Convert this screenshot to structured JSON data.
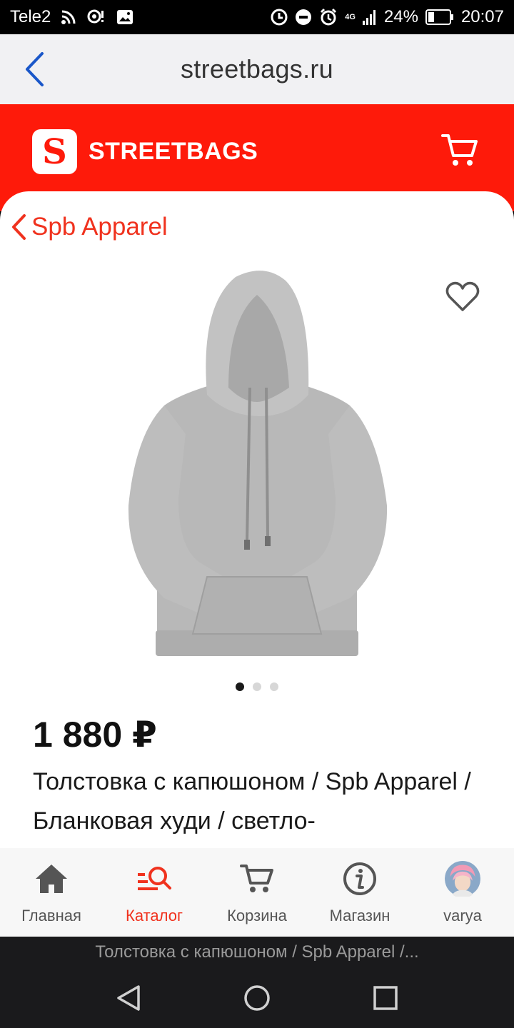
{
  "status_bar": {
    "carrier": "Tele2",
    "network": "4G",
    "battery": "24%",
    "time": "20:07"
  },
  "browser": {
    "url": "streetbags.ru"
  },
  "header": {
    "logo_letter": "S",
    "brand": "STREETBAGS",
    "accent_color": "#fe1a0a"
  },
  "product": {
    "breadcrumb": "Spb Apparel",
    "price": "1 880 ₽",
    "title": "Толстовка с капюшоном / Spb Apparel / Бланковая худи / светло-",
    "image_count": 3,
    "active_image": 1,
    "image_icon": "grey-hoodie"
  },
  "bottom_nav": {
    "items": [
      {
        "label": "Главная",
        "icon": "home-icon"
      },
      {
        "label": "Каталог",
        "icon": "catalog-search-icon"
      },
      {
        "label": "Корзина",
        "icon": "cart-icon"
      },
      {
        "label": "Магазин",
        "icon": "info-icon"
      },
      {
        "label": "varya",
        "icon": "avatar"
      }
    ],
    "active_index": 1
  },
  "page_caption": "Толстовка с капюшоном / Spb Apparel /..."
}
